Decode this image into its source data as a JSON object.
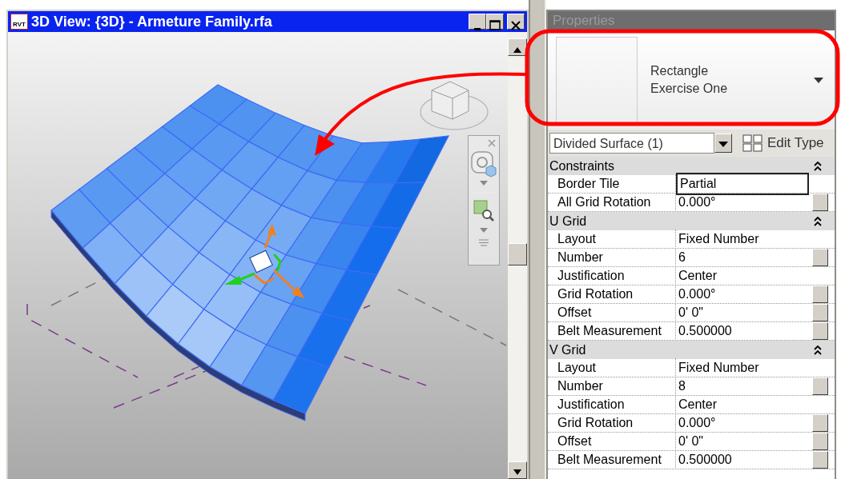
{
  "window": {
    "badge": "RVT",
    "title": "3D View: {3D} - Armeture Family.rfa"
  },
  "properties": {
    "title": "Properties",
    "type_lines": [
      "Rectangle",
      "Exercise One"
    ],
    "selector": "Divided Surface (1)",
    "edit_type": "Edit Type",
    "groups": [
      {
        "name": "Constraints",
        "expanded": true,
        "rows": [
          {
            "label": "Border Tile",
            "value": "Partial",
            "editing": true,
            "has_button": false
          },
          {
            "label": "All Grid Rotation",
            "value": "0.000°",
            "editing": false,
            "has_button": true
          }
        ]
      },
      {
        "name": "U Grid",
        "expanded": true,
        "rows": [
          {
            "label": "Layout",
            "value": "Fixed Number",
            "editing": false,
            "has_button": false
          },
          {
            "label": "Number",
            "value": "6",
            "editing": false,
            "has_button": true
          },
          {
            "label": "Justification",
            "value": "Center",
            "editing": false,
            "has_button": false
          },
          {
            "label": "Grid Rotation",
            "value": "0.000°",
            "editing": false,
            "has_button": true
          },
          {
            "label": "Offset",
            "value": "0'  0\"",
            "editing": false,
            "has_button": true
          },
          {
            "label": "Belt Measurement",
            "value": "0.500000",
            "editing": false,
            "has_button": true
          }
        ]
      },
      {
        "name": "V Grid",
        "expanded": true,
        "rows": [
          {
            "label": "Layout",
            "value": "Fixed Number",
            "editing": false,
            "has_button": false
          },
          {
            "label": "Number",
            "value": "8",
            "editing": false,
            "has_button": true
          },
          {
            "label": "Justification",
            "value": "Center",
            "editing": false,
            "has_button": false
          },
          {
            "label": "Grid Rotation",
            "value": "0.000°",
            "editing": false,
            "has_button": true
          },
          {
            "label": "Offset",
            "value": "0'  0\"",
            "editing": false,
            "has_button": true
          },
          {
            "label": "Belt Measurement",
            "value": "0.500000",
            "editing": false,
            "has_button": true
          }
        ]
      }
    ]
  }
}
